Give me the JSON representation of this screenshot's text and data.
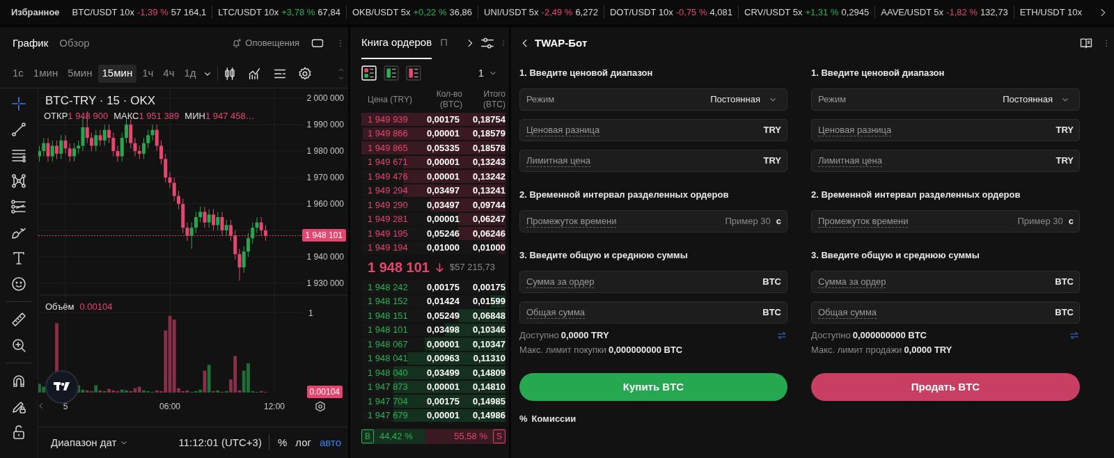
{
  "ticker": {
    "label": "Избранное",
    "items": [
      {
        "pair": "BTC/USDT 10x",
        "change": "-1,39 %",
        "falling": true,
        "price": "57 164,1"
      },
      {
        "pair": "LTC/USDT 10x",
        "change": "+3,78 %",
        "falling": false,
        "price": "67,84"
      },
      {
        "pair": "OKB/USDT 5x",
        "change": "+0,22 %",
        "falling": false,
        "price": "36,86"
      },
      {
        "pair": "UNI/USDT 5x",
        "change": "-2,49 %",
        "falling": true,
        "price": "6,272"
      },
      {
        "pair": "DOT/USDT 10x",
        "change": "-0,75 %",
        "falling": true,
        "price": "4,081"
      },
      {
        "pair": "CRV/USDT 5x",
        "change": "+1,31 %",
        "falling": false,
        "price": "0,2945"
      },
      {
        "pair": "AAVE/USDT 5x",
        "change": "-1,82 %",
        "falling": true,
        "price": "132,73"
      },
      {
        "pair": "ETH/USDT 10x"
      }
    ]
  },
  "chart": {
    "tabs": [
      {
        "label": "График",
        "selected": true
      },
      {
        "label": "Обзор",
        "selected": false
      }
    ],
    "alerts": "Оповещения",
    "timeframes": [
      {
        "label": "1с",
        "selected": false
      },
      {
        "label": "1мин",
        "selected": false
      },
      {
        "label": "5мин",
        "selected": false
      },
      {
        "label": "15мин",
        "selected": true
      },
      {
        "label": "1ч",
        "selected": false
      },
      {
        "label": "4ч",
        "selected": false
      },
      {
        "label": "1д",
        "selected": false
      }
    ],
    "symbol": "BTC-TRY · 15 · OKX",
    "ohlc": [
      {
        "label": "ОТКР",
        "value": "1 948 900"
      },
      {
        "label": "МАКС",
        "value": "1 951 389"
      },
      {
        "label": "МИН",
        "value": "1 947 458…"
      }
    ],
    "chart_data": {
      "type": "candlestick",
      "categories": [
        null,
        null,
        null,
        null,
        null,
        null,
        null,
        null,
        null,
        null,
        null,
        null,
        null,
        null,
        null,
        null,
        null,
        null,
        null,
        null,
        null,
        null,
        null,
        null,
        null,
        null,
        null,
        null,
        null,
        null,
        null,
        null,
        null,
        null,
        null,
        null,
        null,
        null,
        null,
        null,
        null,
        null,
        null,
        null,
        null,
        null,
        null,
        null,
        null,
        null,
        null,
        null,
        null
      ],
      "ohlc": [
        [
          1978000,
          1982000,
          1976000,
          1980000
        ],
        [
          1980000,
          1985000,
          1978000,
          1983000
        ],
        [
          1983000,
          1985000,
          1976000,
          1978000
        ],
        [
          1978000,
          1984000,
          1976000,
          1982000
        ],
        [
          1982000,
          1984000,
          1977000,
          1979000
        ],
        [
          1979000,
          1986000,
          1977000,
          1984000
        ],
        [
          1984000,
          1986000,
          1979000,
          1981000
        ],
        [
          1981000,
          1983000,
          1976000,
          1978000
        ],
        [
          1978000,
          1983000,
          1976000,
          1981000
        ],
        [
          1981000,
          1984000,
          1979000,
          1982000
        ],
        [
          1982000,
          1993000,
          1980000,
          1989000
        ],
        [
          1989000,
          1995000,
          1983000,
          1985000
        ],
        [
          1985000,
          1987000,
          1980000,
          1982000
        ],
        [
          1982000,
          1988000,
          1980000,
          1986000
        ],
        [
          1986000,
          1988000,
          1982000,
          1984000
        ],
        [
          1984000,
          1990000,
          1982000,
          1988000
        ],
        [
          1988000,
          1990000,
          1983000,
          1985000
        ],
        [
          1985000,
          1987000,
          1978000,
          1980000
        ],
        [
          1980000,
          1982000,
          1976000,
          1978000
        ],
        [
          1978000,
          1987000,
          1976000,
          1985000
        ],
        [
          1985000,
          1992000,
          1983000,
          1990000
        ],
        [
          1990000,
          1992000,
          1981000,
          1983000
        ],
        [
          1983000,
          1985000,
          1978000,
          1980000
        ],
        [
          1980000,
          1982000,
          1977000,
          1979000
        ],
        [
          1979000,
          1985000,
          1977000,
          1983000
        ],
        [
          1983000,
          1988000,
          1981000,
          1986000
        ],
        [
          1986000,
          1990000,
          1984000,
          1988000
        ],
        [
          1988000,
          1990000,
          1980000,
          1982000
        ],
        [
          1982000,
          1984000,
          1975000,
          1977000
        ],
        [
          1977000,
          1979000,
          1968000,
          1970000
        ],
        [
          1970000,
          1972000,
          1966000,
          1968000
        ],
        [
          1968000,
          1970000,
          1961000,
          1963000
        ],
        [
          1963000,
          1965000,
          1958000,
          1960000
        ],
        [
          1960000,
          1962000,
          1949000,
          1951000
        ],
        [
          1951000,
          1953000,
          1946000,
          1948000
        ],
        [
          1948000,
          1953000,
          1943000,
          1951000
        ],
        [
          1951000,
          1957000,
          1949000,
          1955000
        ],
        [
          1955000,
          1959000,
          1953000,
          1957000
        ],
        [
          1957000,
          1959000,
          1951000,
          1953000
        ],
        [
          1953000,
          1958000,
          1951000,
          1956000
        ],
        [
          1956000,
          1958000,
          1950000,
          1952000
        ],
        [
          1952000,
          1957000,
          1950000,
          1955000
        ],
        [
          1955000,
          1957000,
          1948000,
          1950000
        ],
        [
          1950000,
          1954000,
          1948000,
          1952000
        ],
        [
          1952000,
          1954000,
          1946000,
          1948000
        ],
        [
          1948000,
          1950000,
          1939000,
          1941000
        ],
        [
          1941000,
          1943000,
          1931000,
          1936000
        ],
        [
          1936000,
          1944000,
          1934000,
          1942000
        ],
        [
          1942000,
          1949000,
          1940000,
          1947000
        ],
        [
          1947000,
          1953000,
          1945000,
          1951000
        ],
        [
          1951000,
          1955000,
          1949000,
          1953000
        ],
        [
          1953000,
          1955000,
          1948000,
          1950000
        ],
        [
          1950000,
          1952000,
          1946000,
          1948000
        ]
      ],
      "yticks": [
        {
          "value": 2000000,
          "label": "2 000 000"
        },
        {
          "value": 1990000,
          "label": "1 990 000"
        },
        {
          "value": 1980000,
          "label": "1 980 000"
        },
        {
          "value": 1970000,
          "label": "1 970 000"
        },
        {
          "value": 1960000,
          "label": "1 960 000"
        },
        {
          "value": 1940000,
          "label": "1 940 000"
        },
        {
          "value": 1930000,
          "label": "1 930 000"
        }
      ],
      "ylim": [
        1925500,
        2003700
      ],
      "grid": true
    },
    "time_ticks": [
      "5",
      "06:00",
      "12:00"
    ],
    "last_price": "1 948 101",
    "volume_label": "Объём",
    "volume_value": "0.00104",
    "volume_tick": "1",
    "volume_badge": "0.00104",
    "date_range": "Диапазон дат",
    "clock": "11:12:01 (UTC+3)",
    "scale_options": [
      {
        "label": "%",
        "selected": false
      },
      {
        "label": "лог",
        "selected": false
      },
      {
        "label": "авто",
        "selected": true
      }
    ]
  },
  "order_book": {
    "tabs": [
      {
        "label": "Книга ордеров",
        "selected": true
      },
      {
        "label": "П",
        "selected": false
      }
    ],
    "view_modes": [
      {
        "kind": "both",
        "selected": true
      },
      {
        "kind": "bids",
        "selected": false
      },
      {
        "kind": "asks",
        "selected": false
      }
    ],
    "depth": "1",
    "columns": [
      "Цена (TRY)",
      "Кол-во (BTC)",
      "Итого (BTC)"
    ],
    "asks": [
      {
        "price": "1 949 939",
        "amount": "0,00175",
        "total": "0,18754",
        "level": 1
      },
      {
        "price": "1 949 866",
        "amount": "0,00001",
        "total": "0,18579",
        "level": 0.99
      },
      {
        "price": "1 949 865",
        "amount": "0,05335",
        "total": "0,18578",
        "level": 1
      },
      {
        "price": "1 949 671",
        "amount": "0,00001",
        "total": "0,13243",
        "level": 0.71
      },
      {
        "price": "1 949 476",
        "amount": "0,00001",
        "total": "0,13242",
        "level": 0.71
      },
      {
        "price": "1 949 294",
        "amount": "0,03497",
        "total": "0,13241",
        "level": 0.71
      },
      {
        "price": "1 949 290",
        "amount": "0,03497",
        "total": "0,09744",
        "level": 0.52
      },
      {
        "price": "1 949 281",
        "amount": "0,00001",
        "total": "0,06247",
        "level": 0.33
      },
      {
        "price": "1 949 195",
        "amount": "0,05246",
        "total": "0,06246",
        "level": 0.33
      },
      {
        "price": "1 949 194",
        "amount": "0,01000",
        "total": "0,01000",
        "level": 0.05
      }
    ],
    "last_price": "1 948 101",
    "falling": true,
    "last_price_usd": "$57 215,73",
    "bids": [
      {
        "price": "1 948 242",
        "amount": "0,00175",
        "total": "0,00175",
        "level": 0.01
      },
      {
        "price": "1 948 152",
        "amount": "0,01424",
        "total": "0,01599",
        "level": 0.1
      },
      {
        "price": "1 948 151",
        "amount": "0,05249",
        "total": "0,06848",
        "level": 0.33
      },
      {
        "price": "1 948 101",
        "amount": "0,03498",
        "total": "0,10346",
        "level": 0.42
      },
      {
        "price": "1 948 067",
        "amount": "0,00001",
        "total": "0,10347",
        "level": 0.56
      },
      {
        "price": "1 948 041",
        "amount": "0,00963",
        "total": "0,11310",
        "level": 0.68
      },
      {
        "price": "1 948 040",
        "amount": "0,03499",
        "total": "0,14809",
        "level": 0.78
      },
      {
        "price": "1 947 873",
        "amount": "0,00001",
        "total": "0,14810",
        "level": 0.78
      },
      {
        "price": "1 947 704",
        "amount": "0,00175",
        "total": "0,14985",
        "level": 0.78
      },
      {
        "price": "1 947 679",
        "amount": "0,00001",
        "total": "0,14986",
        "level": 0.78
      }
    ],
    "buy_label": "B",
    "buy_share": "44,42 %",
    "sell_share": "55,58 %",
    "sell_label": "S",
    "level": 0.4442
  },
  "twap": {
    "title": "TWAP-Бот",
    "forms": [
      {
        "kind": "buy",
        "sections": [
          {
            "heading": "1. Введите ценовой диапазон",
            "fields": [
              {
                "kind": "select",
                "label": "Режим",
                "value": "Постоянная"
              },
              {
                "kind": "input",
                "label": "Ценовая разница",
                "unit": "TRY"
              },
              {
                "kind": "input",
                "label": "Лимитная цена",
                "unit": "TRY"
              }
            ]
          },
          {
            "heading": "2. Временной интервал разделенных ордеров",
            "fields": [
              {
                "kind": "input",
                "label": "Промежуток времени",
                "placeholder": "Пример 30",
                "unit": "с"
              }
            ]
          },
          {
            "heading": "3. Введите общую и среднюю суммы",
            "fields": [
              {
                "kind": "input",
                "label": "Сумма за ордер",
                "unit": "BTC"
              },
              {
                "kind": "input",
                "label": "Общая сумма",
                "unit": "BTC"
              }
            ]
          }
        ],
        "available_label": "Доступно",
        "available_value": "0,0000 TRY",
        "limit_label": "Макс. лимит покупки",
        "limit_value": "0,000000000 BTC",
        "button": "Купить BTC",
        "fees_icon": "%",
        "fees": "Комиссии"
      },
      {
        "kind": "sell",
        "sections": [
          {
            "heading": "1. Введите ценовой диапазон",
            "fields": [
              {
                "kind": "select",
                "label": "Режим",
                "value": "Постоянная"
              },
              {
                "kind": "input",
                "label": "Ценовая разница",
                "unit": "TRY"
              },
              {
                "kind": "input",
                "label": "Лимитная цена",
                "unit": "TRY"
              }
            ]
          },
          {
            "heading": "2. Временной интервал разделенных ордеров",
            "fields": [
              {
                "kind": "input",
                "label": "Промежуток времени",
                "placeholder": "Пример 30",
                "unit": "с"
              }
            ]
          },
          {
            "heading": "3. Введите общую и среднюю суммы",
            "fields": [
              {
                "kind": "input",
                "label": "Сумма за ордер",
                "unit": "BTC"
              },
              {
                "kind": "input",
                "label": "Общая сумма",
                "unit": "BTC"
              }
            ]
          }
        ],
        "available_label": "Доступно",
        "available_value": "0,000000000 BTC",
        "limit_label": "Макс. лимит продажи",
        "limit_value": "0,0000 TRY",
        "button": "Продать BTC"
      }
    ]
  }
}
